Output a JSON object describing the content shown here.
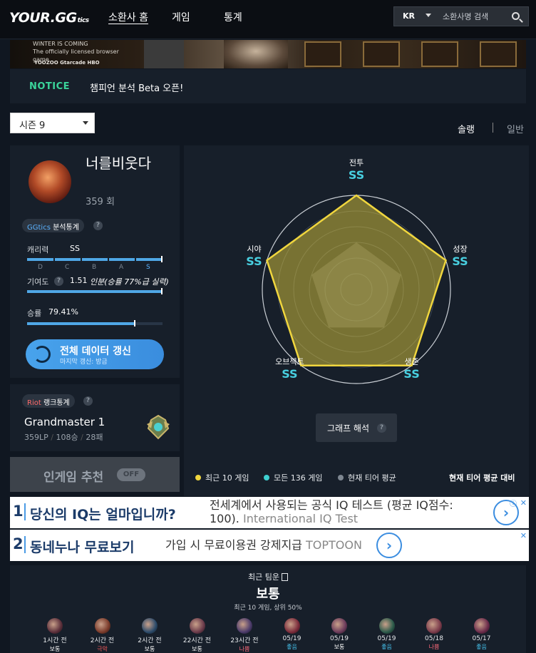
{
  "header": {
    "logo": "YOUR.GG",
    "logo_suffix": "tics",
    "nav": [
      "소환사 홈",
      "게임",
      "통계"
    ],
    "region": "KR",
    "search_placeholder": "소환사명 검색"
  },
  "banner": {
    "line1": "WINTER IS COMING",
    "line2": "The officially licensed browser game",
    "logos": "YOOZOO  Gtarcade      HBO"
  },
  "notice": {
    "tag": "NOTICE",
    "text": "챔피언 분석 Beta 오픈!"
  },
  "season_select": "시즌 9",
  "mode_tabs": [
    "솔랭",
    "일반"
  ],
  "profile": {
    "name": "너를비웃다",
    "games": "359 회",
    "analysis_badge": {
      "brand": "GGtics",
      "label": "분석통계"
    },
    "stats": {
      "skill_label": "캐리력",
      "skill_value": "SS",
      "skill_level": 1.0,
      "grades": [
        "D",
        "C",
        "B",
        "A",
        "S"
      ],
      "contribution_label": "기여도",
      "contribution_value": "1.51",
      "contribution_note": "인분(승률 77%급 실력)",
      "contribution_level": 1.0,
      "winrate_label": "승률",
      "winrate_value": "79.41%",
      "winrate_level": 0.7941
    },
    "refresh": {
      "title": "전체 데이터 갱신",
      "sub": "마지막 갱신: 방금"
    }
  },
  "rank": {
    "badge": {
      "brand": "Riot",
      "label": "랭크통계"
    },
    "tier": "Grandmaster 1",
    "lp": "359LP",
    "wins": "108승",
    "losses": "28패"
  },
  "ingame": {
    "label": "인게임 추천",
    "toggle": "OFF"
  },
  "radar": {
    "axes": [
      {
        "label": "전투",
        "grade": "SS"
      },
      {
        "label": "성장",
        "grade": "SS"
      },
      {
        "label": "생존",
        "grade": "SS"
      },
      {
        "label": "오브젝트",
        "grade": "SS"
      },
      {
        "label": "시야",
        "grade": "SS"
      }
    ],
    "colors": {
      "recent": "#f0d63e",
      "all": "#3ecfd0",
      "tier": "#7e8791"
    },
    "recent_values": [
      1.0,
      1.0,
      1.0,
      1.0,
      1.0
    ],
    "tier_avg_values": [
      0.5,
      0.5,
      0.5,
      0.5,
      0.5
    ],
    "button": "그래프 해석"
  },
  "legend": {
    "recent": "최근 10 게임",
    "all": "모든 136 게임",
    "tier": "현재 티어 평균",
    "compare": "현재 티어 평균 대비"
  },
  "ads": [
    {
      "num": "1",
      "title": "당신의 IQ는 얼마입니까?",
      "desc1": "전세계에서 사용되는 공식 IQ 테스트 (평균 IQ점수:",
      "desc2a": "100).",
      "desc2b": "International IQ Test"
    },
    {
      "num": "2",
      "title": "동네누나 무료보기",
      "desc1": "가입 시 무료이용권 강제지급",
      "desc2b": "TOPTOON"
    }
  ],
  "team": {
    "label": "최근 팀운",
    "title": "보통",
    "sub": "최근 10 게임, 상위 50%",
    "games": [
      {
        "time": "1시간 전",
        "result": "보통",
        "color": "#5a2e3a"
      },
      {
        "time": "2시간 전",
        "result": "극악",
        "color": "#7a3a2a"
      },
      {
        "time": "2시간 전",
        "result": "보통",
        "color": "#2a4a6a"
      },
      {
        "time": "22시간 전",
        "result": "보통",
        "color": "#6a3a4a"
      },
      {
        "time": "23시간 전",
        "result": "나쁨",
        "color": "#4a3a6a"
      },
      {
        "time": "05/19",
        "result": "좋음",
        "color": "#7a2a3a"
      },
      {
        "time": "05/19",
        "result": "보통",
        "color": "#6a3a5a"
      },
      {
        "time": "05/19",
        "result": "좋음",
        "color": "#2a5a4a"
      },
      {
        "time": "05/18",
        "result": "나쁨",
        "color": "#7a3a4a"
      },
      {
        "time": "05/17",
        "result": "좋음",
        "color": "#6a2a4a"
      }
    ],
    "result_colors": {
      "보통": "#ffffff",
      "극악": "#ff5a5a",
      "나쁨": "#ff6a7a",
      "좋음": "#4ad0ff"
    }
  }
}
